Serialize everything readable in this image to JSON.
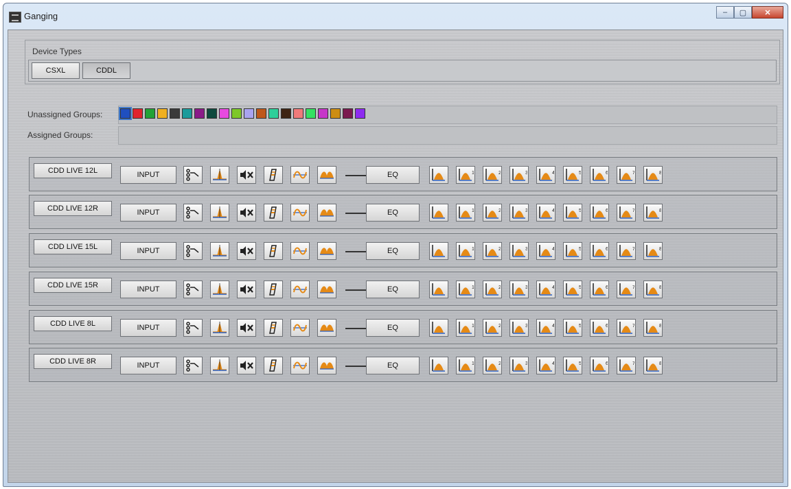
{
  "window": {
    "title": "Ganging"
  },
  "device_types": {
    "label": "Device Types",
    "buttons": [
      "CSXL",
      "CDDL"
    ]
  },
  "groups": {
    "unassigned_label": "Unassigned Groups:",
    "assigned_label": "Assigned Groups:",
    "colors": [
      "#1f4fbf",
      "#e0242d",
      "#22a236",
      "#f0b021",
      "#3a3a3a",
      "#1b9b9b",
      "#8a1b88",
      "#0e4a3e",
      "#e84ae0",
      "#7ec829",
      "#a9a3f0",
      "#bf581b",
      "#2fcf9a",
      "#3e2413",
      "#ef7a7a",
      "#36e062",
      "#c637c9",
      "#cd8d13",
      "#7b1a4f",
      "#8d2bf0"
    ]
  },
  "devices": [
    {
      "name": "CDD LIVE 12L",
      "input_label": "INPUT",
      "eq_label": "EQ"
    },
    {
      "name": "CDD LIVE 12R",
      "input_label": "INPUT",
      "eq_label": "EQ"
    },
    {
      "name": "CDD LIVE 15L",
      "input_label": "INPUT",
      "eq_label": "EQ"
    },
    {
      "name": "CDD LIVE 15R",
      "input_label": "INPUT",
      "eq_label": "EQ"
    },
    {
      "name": "CDD LIVE 8L",
      "input_label": "INPUT",
      "eq_label": "EQ"
    },
    {
      "name": "CDD LIVE 8R",
      "input_label": "INPUT",
      "eq_label": "EQ"
    }
  ],
  "input_icons": [
    "routing-icon",
    "filter-peak-icon",
    "mute-icon",
    "polarity-icon",
    "highpass-lowpass-icon",
    "crossover-icon"
  ],
  "eq_bands": [
    "",
    "1",
    "2",
    "3",
    "4",
    "5",
    "6",
    "7",
    "8"
  ]
}
